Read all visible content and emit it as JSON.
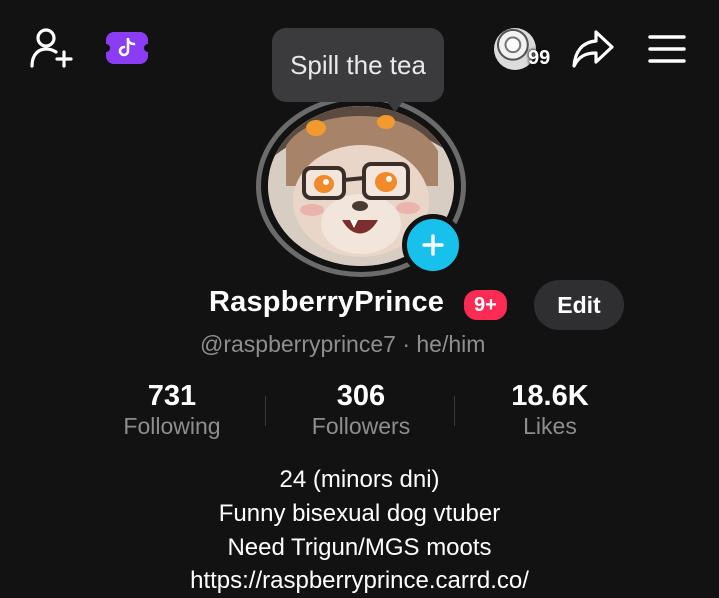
{
  "header": {
    "notification_count": "99",
    "tooltip_text": "Spill the tea"
  },
  "profile": {
    "display_name": "RaspberryPrince",
    "badge_text": "9+",
    "edit_label": "Edit",
    "handle_line": "@raspberryprince7 · he/him"
  },
  "stats": [
    {
      "value": "731",
      "label": "Following"
    },
    {
      "value": "306",
      "label": "Followers"
    },
    {
      "value": "18.6K",
      "label": "Likes"
    }
  ],
  "bio": {
    "line1": "24 (minors dni)",
    "line2": "Funny bisexual dog vtuber",
    "line3": "Need Trigun/MGS moots",
    "link": "https://raspberryprince.carrd.co/"
  },
  "colors": {
    "background": "#121212",
    "accent_pink": "#fe2c55",
    "accent_cyan": "#18c1ec",
    "promo_purple": "#8b3df5",
    "muted_text": "#8e8e8e"
  },
  "icons": [
    "add-friend-icon",
    "tiktok-promo-icon",
    "share-icon",
    "menu-icon",
    "plus-icon"
  ]
}
